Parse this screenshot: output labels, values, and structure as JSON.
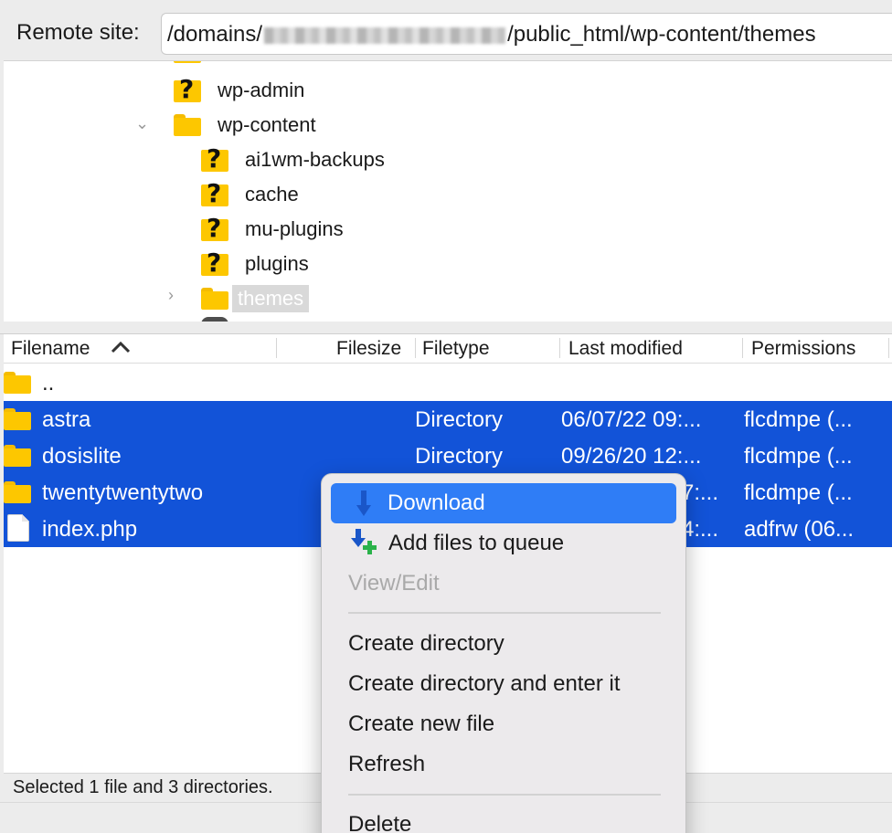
{
  "remote": {
    "label": "Remote site:",
    "path_prefix": "/domains/",
    "path_suffix": "/public_html/wp-content/themes"
  },
  "tree": {
    "items": [
      {
        "label": "wp-admin",
        "icon": "question-folder-icon"
      },
      {
        "label": "wp-content",
        "icon": "folder-icon",
        "expanded": true
      },
      {
        "label": "ai1wm-backups",
        "icon": "question-folder-icon"
      },
      {
        "label": "cache",
        "icon": "question-folder-icon"
      },
      {
        "label": "mu-plugins",
        "icon": "question-folder-icon"
      },
      {
        "label": "plugins",
        "icon": "question-folder-icon"
      },
      {
        "label": "themes",
        "icon": "folder-icon",
        "selected": true
      }
    ]
  },
  "columns": {
    "filename": "Filename",
    "filesize": "Filesize",
    "filetype": "Filetype",
    "last_modified": "Last modified",
    "permissions": "Permissions"
  },
  "files": [
    {
      "name": "..",
      "type": "",
      "modified": "",
      "perms": "",
      "selected": false,
      "icon": "folder-icon"
    },
    {
      "name": "astra",
      "type": "Directory",
      "modified": "06/07/22 09:...",
      "perms": "flcdmpe (...",
      "selected": true,
      "icon": "folder-icon"
    },
    {
      "name": "dosislite",
      "type": "Directory",
      "modified": "09/26/20 12:...",
      "perms": "flcdmpe (...",
      "selected": true,
      "icon": "folder-icon"
    },
    {
      "name": "twentytwentytwo",
      "type": "",
      "modified": "7:...",
      "perms": "flcdmpe (...",
      "selected": true,
      "icon": "folder-icon"
    },
    {
      "name": "index.php",
      "type": "",
      "modified": "4:...",
      "perms": "adfrw (06...",
      "selected": true,
      "icon": "file-icon"
    }
  ],
  "status": {
    "text": "Selected 1 file and 3 directories."
  },
  "context_menu": {
    "items": [
      {
        "label": "Download",
        "highlighted": true
      },
      {
        "label": "Add files to queue"
      },
      {
        "label": "View/Edit",
        "disabled": true
      },
      {
        "label": "Create directory"
      },
      {
        "label": "Create directory and enter it"
      },
      {
        "label": "Create new file"
      },
      {
        "label": "Refresh"
      },
      {
        "label": "Delete"
      }
    ]
  },
  "colors": {
    "selection": "#1253d8",
    "menu_highlight": "#2f7df6",
    "folder": "#fdc700"
  }
}
